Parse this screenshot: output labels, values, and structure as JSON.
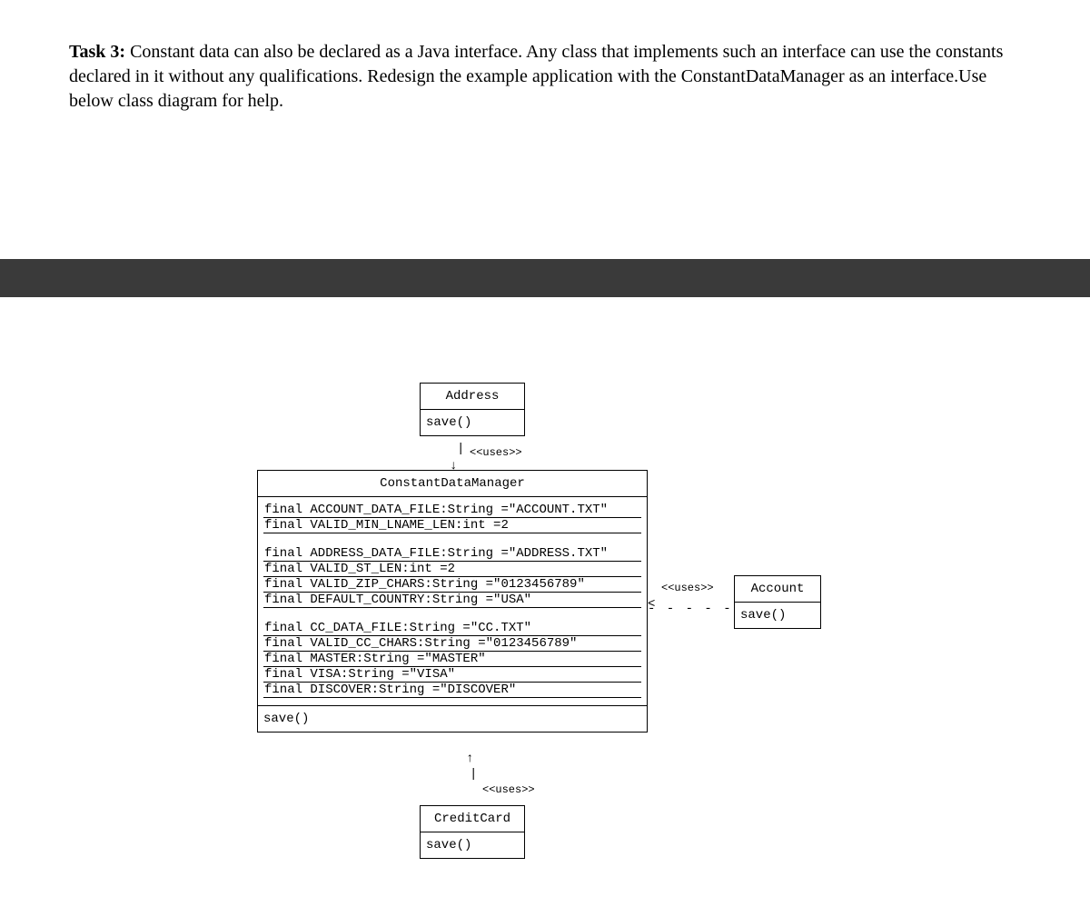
{
  "task": {
    "label": "Task 3:",
    "text": "Constant data can also be declared as a Java interface. Any class that implements such an interface can use the constants declared in it without any qualifications. Redesign the example application with the ConstantDataManager as an interface.Use below class diagram for help."
  },
  "uses_label": "<<uses>>",
  "address": {
    "name": "Address",
    "method": "save()"
  },
  "cdm": {
    "name": "ConstantDataManager",
    "a1": "final ACCOUNT_DATA_FILE:String =\"ACCOUNT.TXT\"",
    "a2": "final VALID_MIN_LNAME_LEN:int =2",
    "a3": "final ADDRESS_DATA_FILE:String =\"ADDRESS.TXT\"",
    "a4": "final VALID_ST_LEN:int =2",
    "a5": "final VALID_ZIP_CHARS:String =\"0123456789\"",
    "a6": "final DEFAULT_COUNTRY:String =\"USA\"",
    "a7": "final CC_DATA_FILE:String =\"CC.TXT\"",
    "a8": "final VALID_CC_CHARS:String =\"0123456789\"",
    "a9": "final MASTER:String =\"MASTER\"",
    "a10": "final VISA:String =\"VISA\"",
    "a11": "final DISCOVER:String =\"DISCOVER\"",
    "method": "save()"
  },
  "account": {
    "name": "Account",
    "method": "save()"
  },
  "creditcard": {
    "name": "CreditCard",
    "method": "save()"
  }
}
